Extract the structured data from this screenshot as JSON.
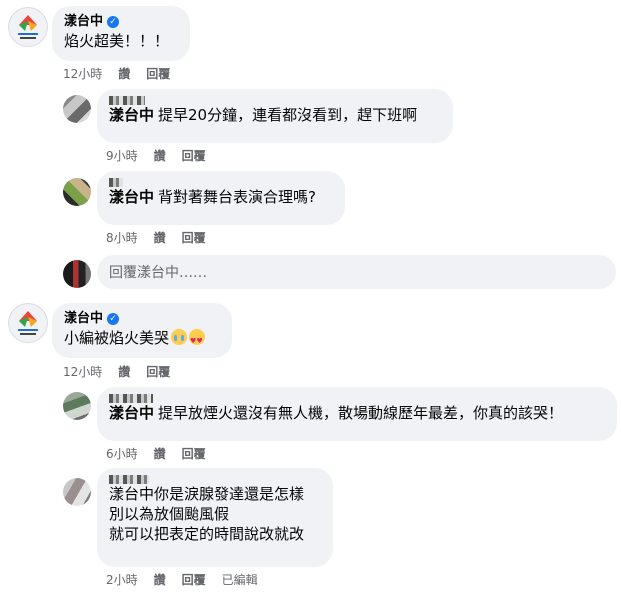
{
  "comments": [
    {
      "author": "漾台中",
      "text": "焰火超美！！！",
      "time": "12小時",
      "like": "讚",
      "reply": "回覆",
      "replies": [
        {
          "mention": "漾台中",
          "text": "提早20分鐘，連看都沒看到，趕下班啊",
          "time": "9小時",
          "like": "讚",
          "reply": "回覆"
        },
        {
          "mention": "漾台中",
          "text": "背對著舞台表演合理嗎?",
          "time": "8小時",
          "like": "讚",
          "reply": "回覆"
        }
      ],
      "reply_placeholder": "回覆漾台中……"
    },
    {
      "author": "漾台中",
      "text": "小編被焰火美哭",
      "emojis": [
        "crying-face",
        "heart-eyes-face"
      ],
      "time": "12小時",
      "like": "讚",
      "reply": "回覆",
      "replies": [
        {
          "mention": "漾台中",
          "text": "提早放煙火還沒有無人機，散場動線歷年最差，你真的該哭！",
          "time": "6小時",
          "like": "讚",
          "reply": "回覆"
        },
        {
          "text": "漾台中你是淚腺發達還是怎樣\n別以為放個颱風假\n就可以把表定的時間說改就改",
          "time": "2小時",
          "like": "讚",
          "reply": "回覆",
          "edited": "已編輯"
        }
      ]
    }
  ],
  "colors": {
    "bubble": "#f0f2f5",
    "meta": "#65676b",
    "verified": "#1877f2"
  }
}
